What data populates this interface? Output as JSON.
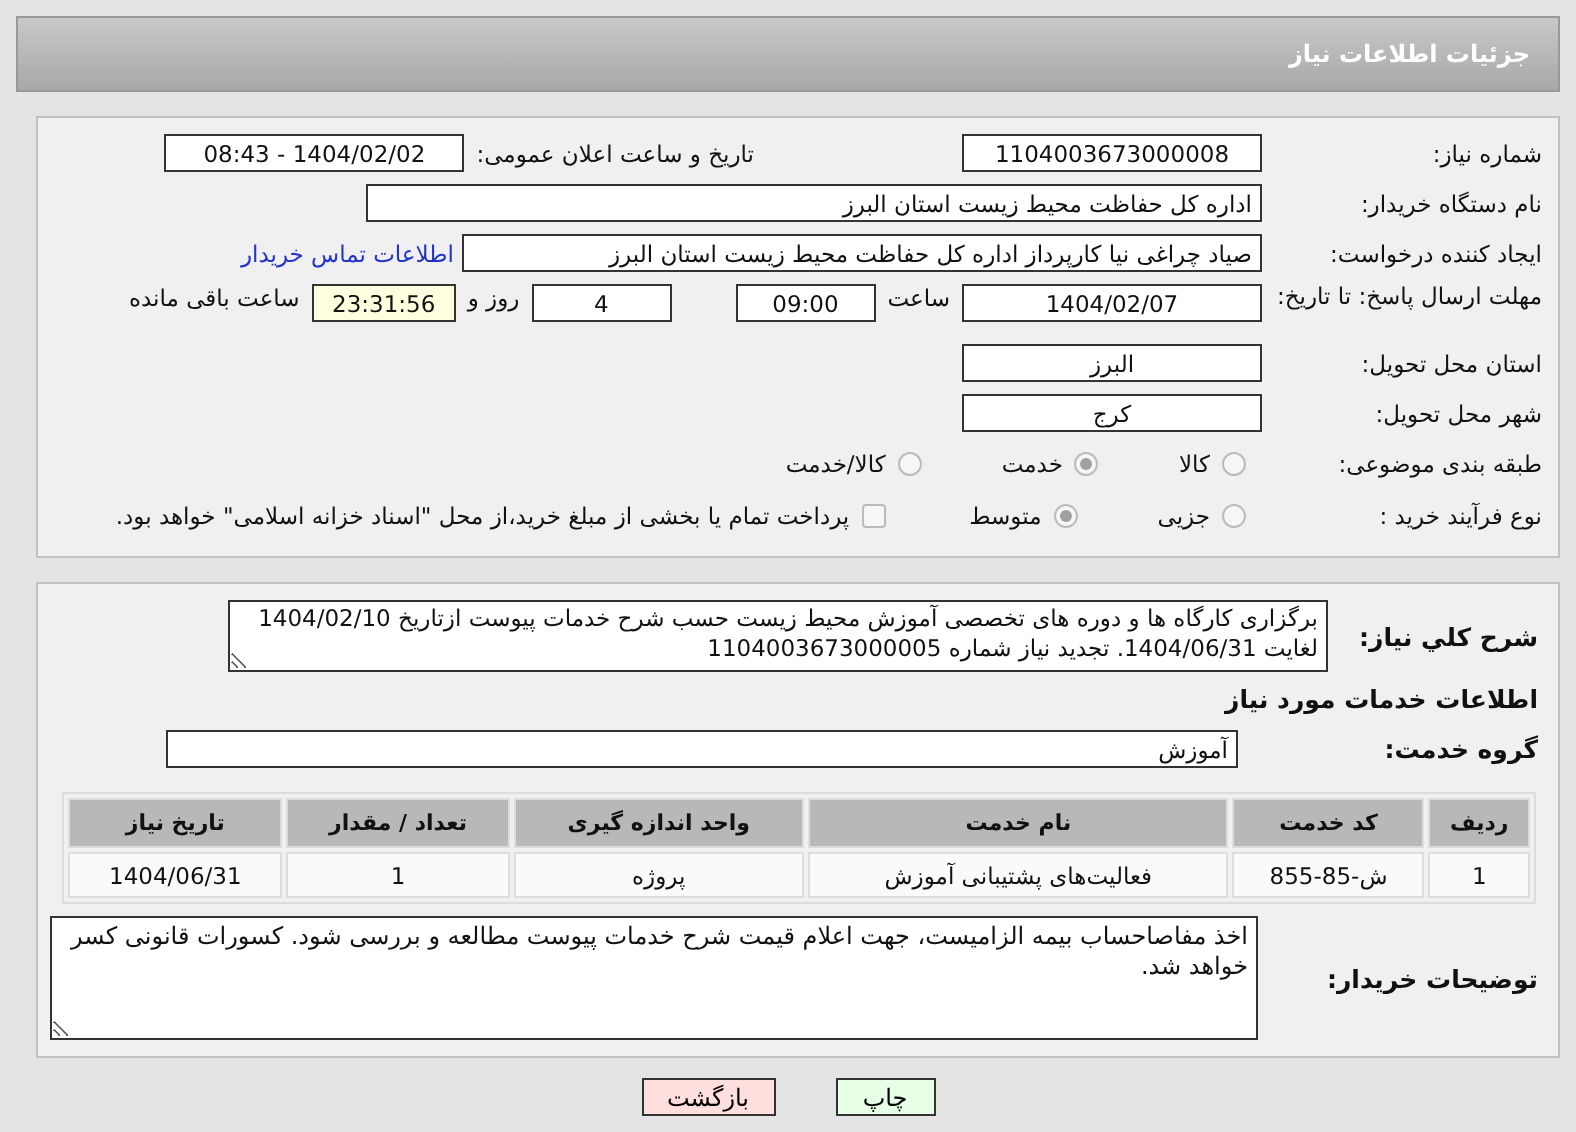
{
  "header": {
    "title": "جزئیات اطلاعات نیاز"
  },
  "need_number": {
    "label": "شماره نیاز:",
    "value": "1104003673000008"
  },
  "announce": {
    "label": "تاریخ و ساعت اعلان عمومی:",
    "value": "1404/02/02 - 08:43"
  },
  "buyer_org": {
    "label": "نام دستگاه خریدار:",
    "value": "اداره کل حفاظت محیط زیست استان البرز"
  },
  "requester": {
    "label": "ایجاد کننده درخواست:",
    "value": "صیاد چراغی نیا کارپرداز اداره کل حفاظت محیط زیست استان البرز",
    "link": "اطلاعات تماس خریدار"
  },
  "deadline": {
    "label": "مهلت ارسال پاسخ: تا تاریخ:",
    "date": "1404/02/07",
    "time_label": "ساعت",
    "time": "09:00",
    "days": "4",
    "days_label": "روز و",
    "remaining": "23:31:56",
    "remaining_label": "ساعت باقی مانده"
  },
  "province": {
    "label": "استان محل تحویل:",
    "value": "البرز"
  },
  "city": {
    "label": "شهر محل تحویل:",
    "value": "کرج"
  },
  "category": {
    "label": "طبقه بندی موضوعی:",
    "options": [
      {
        "label": "کالا",
        "selected": false
      },
      {
        "label": "خدمت",
        "selected": true
      },
      {
        "label": "کالا/خدمت",
        "selected": false
      }
    ]
  },
  "process": {
    "label": "نوع فرآیند خرید :",
    "options": [
      {
        "label": "جزیی",
        "selected": false
      },
      {
        "label": "متوسط",
        "selected": true
      }
    ],
    "payment": {
      "label": "پرداخت تمام یا بخشی از مبلغ خرید،از محل \"اسناد خزانه اسلامی\" خواهد بود.",
      "checked": false
    }
  },
  "description": {
    "label": "شرح کلي نياز:",
    "value": "برگزاری کارگاه ها و دوره های تخصصی آموزش محیط زیست حسب شرح خدمات پیوست ازتاریخ 1404/02/10 لغایت 1404/06/31. تجدید نیاز شماره 1104003673000005"
  },
  "services_heading": "اطلاعات خدمات مورد نیاز",
  "service_group": {
    "label": "گروه خدمت:",
    "value": "آموزش"
  },
  "table": {
    "columns": [
      "ردیف",
      "کد خدمت",
      "نام خدمت",
      "واحد اندازه گیری",
      "تعداد / مقدار",
      "تاریخ نیاز"
    ],
    "rows": [
      [
        "1",
        "ش-85-855",
        "فعالیت‌های پشتیبانی آموزش",
        "پروژه",
        "1",
        "1404/06/31"
      ]
    ]
  },
  "buyer_notes": {
    "label": "توضیحات خریدار:",
    "value": "اخذ مفاصاحساب بیمه الزامیست، جهت اعلام قیمت شرح خدمات پیوست مطالعه و بررسی شود. کسورات قانونی کسر خواهد شد."
  },
  "buttons": [
    {
      "label": "چاپ",
      "kind": "print"
    },
    {
      "label": "بازگشت",
      "kind": "back"
    }
  ]
}
